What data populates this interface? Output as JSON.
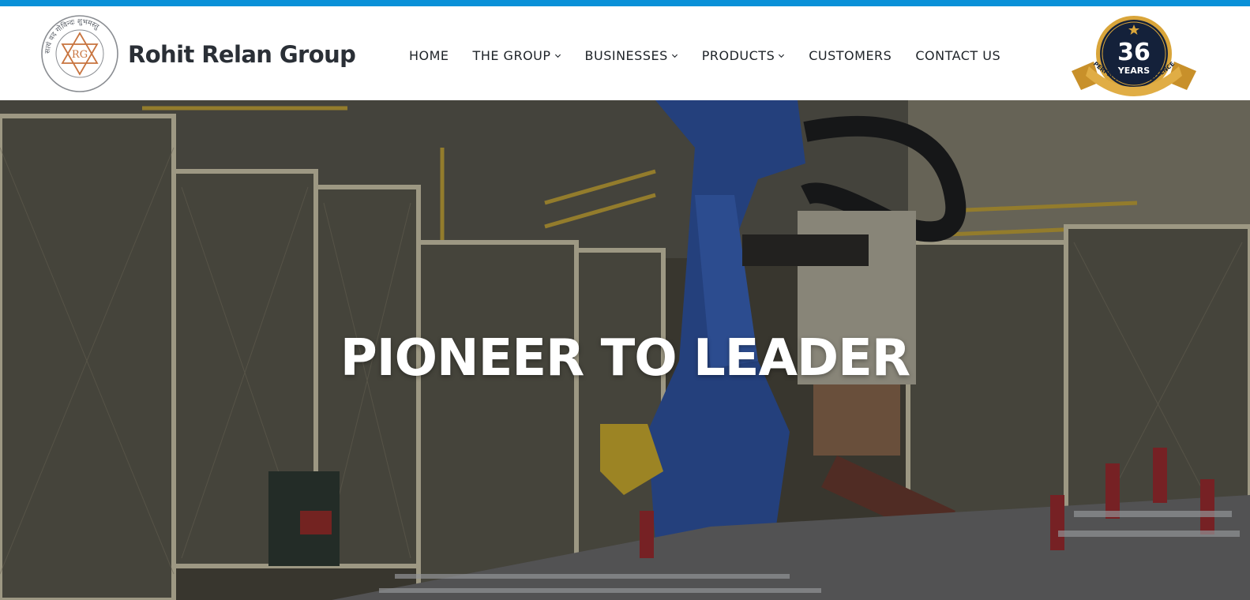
{
  "brand": {
    "name": "Rohit Relan Group",
    "logo_monogram": "RG",
    "logo_ring_text": "सत्यं वद गोविन्दः शुभमस्तु"
  },
  "nav": {
    "items": [
      {
        "label": "HOME",
        "has_dropdown": false
      },
      {
        "label": "THE GROUP",
        "has_dropdown": true
      },
      {
        "label": "BUSINESSES",
        "has_dropdown": true
      },
      {
        "label": "PRODUCTS",
        "has_dropdown": true
      },
      {
        "label": "CUSTOMERS",
        "has_dropdown": false
      },
      {
        "label": "CONTACT US",
        "has_dropdown": false
      }
    ]
  },
  "badge": {
    "number": "36",
    "unit": "YEARS",
    "ribbon": "PERFECTION & EXCELLENCE"
  },
  "hero": {
    "title": "PIONEER TO LEADER",
    "icon": "industrial-robot-scene"
  },
  "colors": {
    "topbar": "#0a91d8",
    "brand_text": "#2a2f36",
    "nav_text": "#1e2328",
    "badge_gold": "#d9a53a",
    "badge_navy": "#14213a",
    "logo_accent": "#c8743f"
  }
}
